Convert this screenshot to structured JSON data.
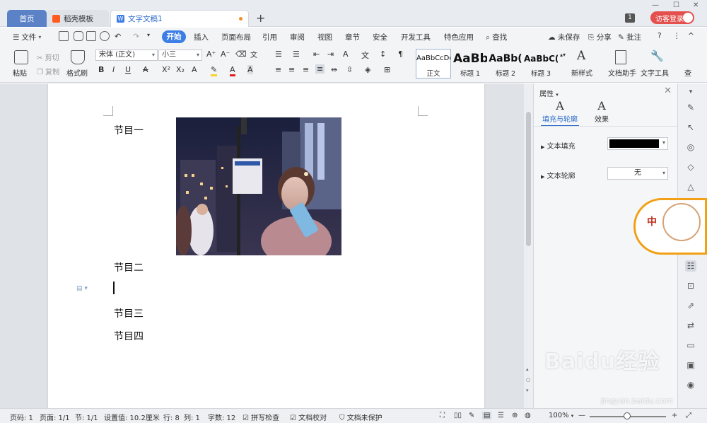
{
  "titlebar": {
    "tabs": [
      {
        "label": "首页"
      },
      {
        "label": "稻壳模板"
      },
      {
        "label": "文字文稿1"
      }
    ],
    "add_tab": "+",
    "window_count": "1",
    "login": "访客登录"
  },
  "menu": {
    "file": "文件",
    "start": "开始",
    "items": [
      "插入",
      "页面布局",
      "引用",
      "审阅",
      "视图",
      "章节",
      "安全",
      "开发工具",
      "特色应用"
    ],
    "search": "查找",
    "unsaved": "未保存",
    "share": "分享",
    "comment": "批注"
  },
  "ribbon": {
    "paste": "粘贴",
    "cut": "剪切",
    "copy": "复制",
    "format_painter": "格式刷",
    "font_name": "宋体 (正文)",
    "font_size": "小三",
    "styles": [
      {
        "sample": "AaBbCcDd",
        "label": "正文"
      },
      {
        "sample": "AaBb",
        "label": "标题 1"
      },
      {
        "sample": "AaBb(",
        "label": "标题 2"
      },
      {
        "sample": "AaBbC(",
        "label": "标题 3"
      }
    ],
    "new_style": "新样式",
    "doc_helper": "文档助手",
    "text_tools": "文字工具",
    "find_replace": "查"
  },
  "document": {
    "lines": [
      "节目一",
      "节目二",
      "节目三",
      "节目四"
    ]
  },
  "panel": {
    "title": "属性",
    "tabs": [
      {
        "icon": "A",
        "label": "填充与轮廓"
      },
      {
        "icon": "A",
        "label": "效果"
      }
    ],
    "text_fill": "文本填充",
    "text_outline": "文本轮廓",
    "outline_value": "无",
    "fill_color": "#000000"
  },
  "mascot": {
    "char": "中"
  },
  "status": {
    "page_num": "页码: 1",
    "pages": "页面: 1/1",
    "section": "节: 1/1",
    "setting": "设置值: 10.2厘米",
    "row": "行: 8",
    "col": "列: 1",
    "words": "字数: 12",
    "spell": "拼写检查",
    "proof": "文档校对",
    "protect": "文档未保护",
    "zoom": "100%"
  },
  "watermark": {
    "main": "Baidu经验",
    "sub": "jingyan.baidu.com"
  }
}
